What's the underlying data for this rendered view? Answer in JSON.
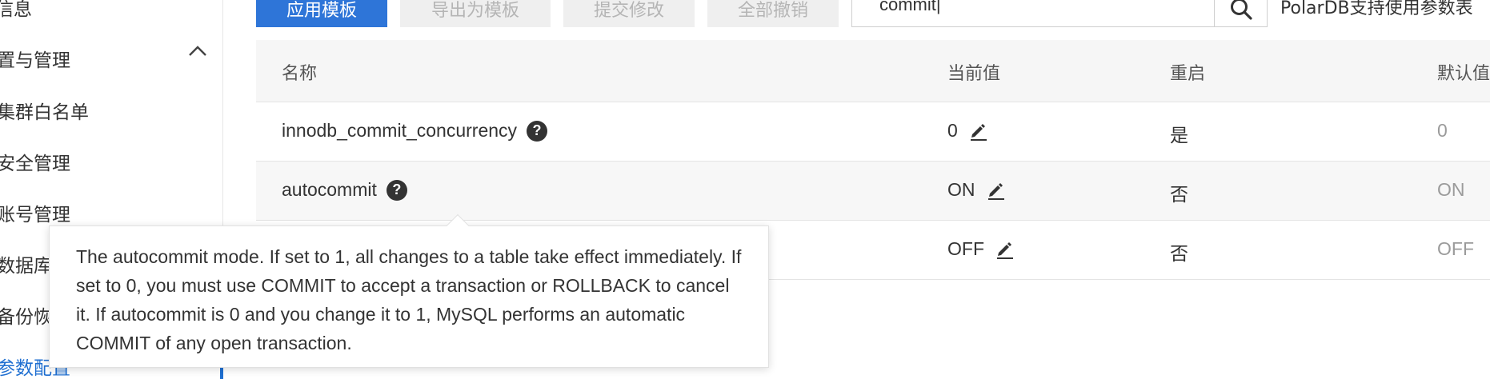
{
  "sidebar": {
    "items": [
      {
        "label": "信息"
      },
      {
        "label": "置与管理"
      },
      {
        "label": "集群白名单"
      },
      {
        "label": "安全管理"
      },
      {
        "label": "账号管理"
      },
      {
        "label": "数据库"
      },
      {
        "label": "备份恢"
      },
      {
        "label": "参数配置"
      }
    ]
  },
  "toolbar": {
    "apply_template": "应用模板",
    "export_template": "导出为模板",
    "submit_changes": "提交修改",
    "revoke_all": "全部撤销"
  },
  "search": {
    "value": "commit|"
  },
  "note": "PolarDB支持使用参数表",
  "table": {
    "headers": {
      "name": "名称",
      "current_value": "当前值",
      "restart": "重启",
      "default_value": "默认值"
    },
    "rows": [
      {
        "name": "innodb_commit_concurrency",
        "current_value": "0",
        "restart": "是",
        "default_value": "0"
      },
      {
        "name": "autocommit",
        "current_value": "ON",
        "restart": "否",
        "default_value": "ON"
      },
      {
        "name": "",
        "current_value": "OFF",
        "restart": "否",
        "default_value": "OFF"
      }
    ]
  },
  "tooltip": {
    "text": "The autocommit mode. If set to 1, all changes to a table take effect immediately. If set to 0, you must use COMMIT to accept a transaction or ROLLBACK to cancel it. If autocommit is 0 and you change it to 1, MySQL performs an automatic COMMIT of any open transaction."
  },
  "icons": {
    "help": "question-circle-icon",
    "edit": "pencil-icon",
    "search": "search-icon",
    "chevron": "chevron-up-icon"
  },
  "colors": {
    "primary": "#2e75d8",
    "active_link": "#1f6fd1"
  }
}
